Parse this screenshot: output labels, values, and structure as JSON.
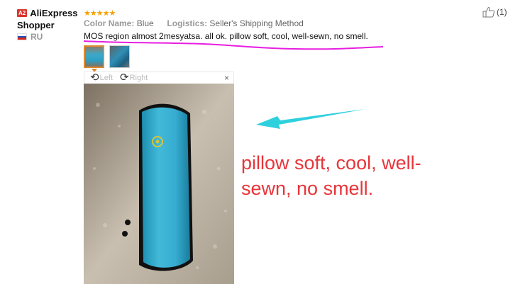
{
  "reviewer": {
    "badge": "A2",
    "name_line1": "AliExpress",
    "name_line2": "Shopper",
    "country": "RU"
  },
  "rating": {
    "stars_text": "★★★★★",
    "value": 5,
    "max": 5
  },
  "meta": {
    "color_label": "Color Name:",
    "color_value": "Blue",
    "logistics_label": "Logistics:",
    "logistics_value": "Seller's Shipping Method"
  },
  "review": {
    "text": "MOS region almost 2mesyatsa. all ok. pillow soft, cool, well-sewn, no smell."
  },
  "helpful": {
    "count_text": "(1)"
  },
  "viewer": {
    "rotate_left_label": "Left",
    "rotate_right_label": "Right",
    "close_glyph": "×"
  },
  "annotation": {
    "line1": "pillow soft, cool, well-",
    "line2": "sewn, no smell."
  },
  "colors": {
    "annotation_red": "#e8353a",
    "highlight_magenta": "#e81ee0",
    "arrow_cyan": "#2fd0de",
    "star_orange": "#f5a000",
    "selected_thumb_border": "#e0892f"
  },
  "icons": {
    "thumbs_up": "thumbs-up-icon",
    "rotate_left": "rotate-left-icon",
    "rotate_right": "rotate-right-icon",
    "close": "close-icon",
    "flag": "russia-flag-icon"
  }
}
